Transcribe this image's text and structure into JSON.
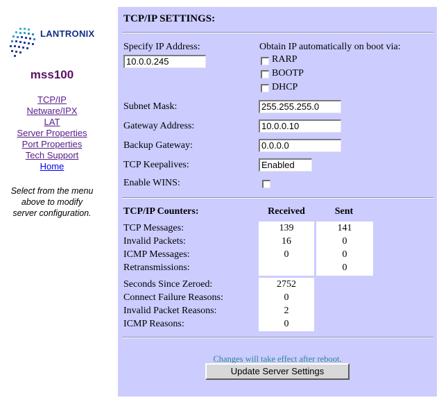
{
  "brand": {
    "logo_text": "LANTRONIX",
    "server_name": "mss100"
  },
  "nav": {
    "items": [
      "TCP/IP",
      "Netware/IPX",
      "LAT",
      "Server Properties",
      "Port Properties",
      "Tech Support",
      "Home"
    ],
    "help_lines": [
      "Select from the menu",
      "above to modify",
      "server configuration."
    ]
  },
  "settings": {
    "title": "TCP/IP SETTINGS:",
    "ip_label": "Specify IP Address:",
    "ip_value": "10.0.0.245",
    "obtain_label": "Obtain IP automatically on boot via:",
    "obtain_options": [
      "RARP",
      "BOOTP",
      "DHCP"
    ],
    "subnet_label": "Subnet Mask:",
    "subnet_value": "255.255.255.0",
    "gateway_label": "Gateway Address:",
    "gateway_value": "10.0.0.10",
    "backup_label": "Backup Gateway:",
    "backup_value": "0.0.0.0",
    "keepalive_label": "TCP Keepalives:",
    "keepalive_value": "Enabled",
    "wins_label": "Enable WINS:"
  },
  "counters": {
    "title": "TCP/IP Counters:",
    "col_received": "Received",
    "col_sent": "Sent",
    "rows": [
      {
        "label": "TCP Messages:",
        "received": "139",
        "sent": "141"
      },
      {
        "label": "Invalid Packets:",
        "received": "16",
        "sent": "0"
      },
      {
        "label": "ICMP Messages:",
        "received": "0",
        "sent": "0"
      },
      {
        "label": "Retransmissions:",
        "received": "",
        "sent": "0"
      }
    ],
    "stats": [
      {
        "label": "Seconds Since Zeroed:",
        "value": "2752"
      },
      {
        "label": "Connect Failure Reasons:",
        "value": "0"
      },
      {
        "label": "Invalid Packet Reasons:",
        "value": "2"
      },
      {
        "label": "ICMP Reasons:",
        "value": "0"
      }
    ]
  },
  "footer": {
    "note": "Changes will take effect after reboot.",
    "button_label": "Update Server Settings"
  }
}
